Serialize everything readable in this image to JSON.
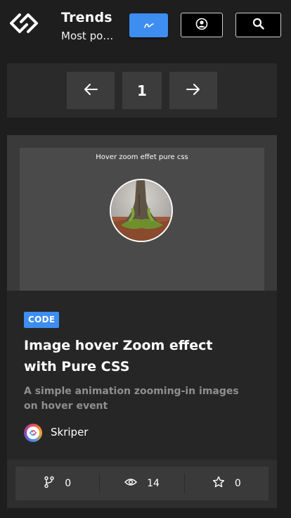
{
  "header": {
    "title": "Trends",
    "subtitle": "Most popular"
  },
  "pagination": {
    "current_page": "1"
  },
  "card": {
    "preview_title": "Hover zoom effet pure css",
    "tag": "CODE",
    "title": "Image hover Zoom effect with Pure CSS",
    "description": "A simple animation zooming-in images on hover event",
    "author": "Skriper",
    "stats": {
      "forks": "0",
      "views": "14",
      "stars": "0"
    }
  },
  "colors": {
    "accent": "#3d8ef0",
    "background": "#1e1e1e"
  },
  "icons": [
    "logo-icon",
    "trend-icon",
    "user-icon",
    "search-icon",
    "arrow-left-icon",
    "arrow-right-icon",
    "fork-icon",
    "eye-icon",
    "star-icon"
  ]
}
